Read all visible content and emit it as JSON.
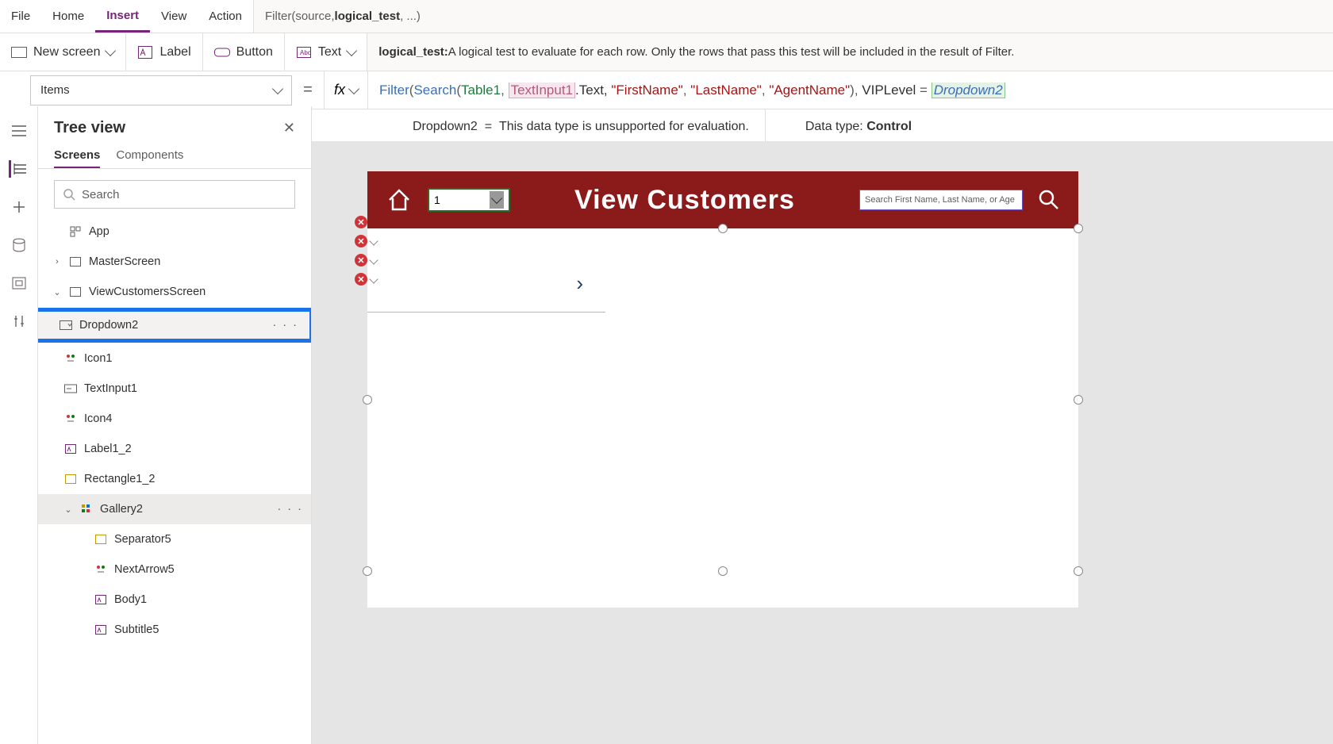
{
  "menu": {
    "file": "File",
    "home": "Home",
    "insert": "Insert",
    "view": "View",
    "action": "Action",
    "hint_pre": "Filter(source, ",
    "hint_bold": "logical_test",
    "hint_post": ", ...)"
  },
  "ribbon": {
    "newscreen": "New screen",
    "label": "Label",
    "button": "Button",
    "text": "Text",
    "info_b": "logical_test:",
    "info": " A logical test to evaluate for each row. Only the rows that pass this test will be included in the result of Filter."
  },
  "prop": "Items",
  "eq": "=",
  "fx": "fx",
  "formula": {
    "f_filter": "Filter",
    "p1": "(",
    "f_search": "Search",
    "p2": "(",
    "tbl": "Table1",
    "c1": ", ",
    "ti": "TextInput1",
    "dot": ".Text, ",
    "s1": "\"FirstName\"",
    "c2": ", ",
    "s2": "\"LastName\"",
    "c3": ", ",
    "s3": "\"AgentName\"",
    "p3": ")",
    "c4": ", ",
    "vip": "VIPLevel ",
    "opeq": "= ",
    "dd": "Dropdown2"
  },
  "eval": {
    "lhs": "Dropdown2",
    "eq": "=",
    "msg": "This data type is unsupported for evaluation.",
    "dtlabel": "Data type:",
    "dt": "Control"
  },
  "tree": {
    "title": "Tree view",
    "tabs": {
      "screens": "Screens",
      "components": "Components"
    },
    "search_placeholder": "Search",
    "app": "App",
    "master": "MasterScreen",
    "view": "ViewCustomersScreen",
    "dropdown": "Dropdown2",
    "icon1": "Icon1",
    "textinput": "TextInput1",
    "icon4": "Icon4",
    "label12": "Label1_2",
    "rect": "Rectangle1_2",
    "gallery": "Gallery2",
    "sep": "Separator5",
    "nextarrow": "NextArrow5",
    "body": "Body1",
    "subtitle": "Subtitle5"
  },
  "canvas": {
    "dropdown_value": "1",
    "title": "View Customers",
    "search_placeholder": "Search First Name, Last Name, or Age"
  }
}
